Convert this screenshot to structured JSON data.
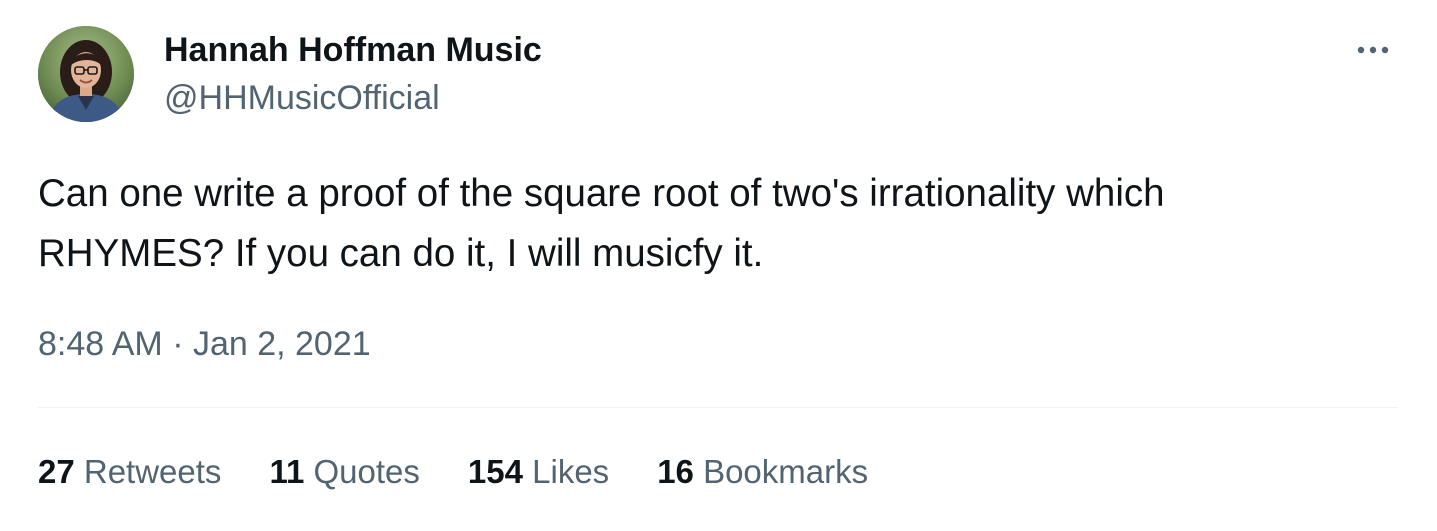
{
  "tweet": {
    "author": {
      "display_name": "Hannah Hoffman Music",
      "handle": "@HHMusicOfficial"
    },
    "more_icon": "more-horizontal-icon",
    "text_lines": [
      "Can one write a proof of the square root of two's irrationality which",
      "RHYMES? If you can do it, I will musicfy it."
    ],
    "timestamp": "8:48 AM · Jan 2, 2021",
    "stats": {
      "retweets": {
        "count": "27",
        "label": "Retweets"
      },
      "quotes": {
        "count": "11",
        "label": "Quotes"
      },
      "likes": {
        "count": "154",
        "label": "Likes"
      },
      "bookmarks": {
        "count": "16",
        "label": "Bookmarks"
      }
    },
    "colors": {
      "primary_text": "#0f1419",
      "secondary_text": "#536471",
      "divider": "#eff3f4"
    }
  }
}
